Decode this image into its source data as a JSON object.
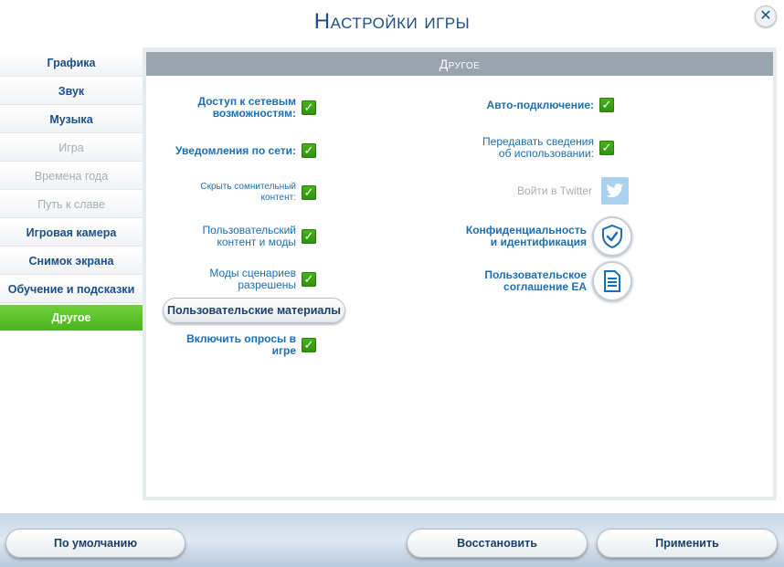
{
  "window": {
    "title": "Настройки игры",
    "close_label": "✕"
  },
  "sidebar": {
    "items": [
      {
        "label": "Графика",
        "state": "normal"
      },
      {
        "label": "Звук",
        "state": "normal"
      },
      {
        "label": "Музыка",
        "state": "normal"
      },
      {
        "label": "Игра",
        "state": "disabled"
      },
      {
        "label": "Времена года",
        "state": "disabled"
      },
      {
        "label": "Путь к славе",
        "state": "disabled"
      },
      {
        "label": "Игровая камера",
        "state": "normal"
      },
      {
        "label": "Снимок экрана",
        "state": "normal"
      },
      {
        "label": "Обучение и подсказки",
        "state": "normal"
      },
      {
        "label": "Другое",
        "state": "active"
      }
    ]
  },
  "panel": {
    "header": "Другое",
    "left_options": [
      {
        "label": "Доступ к сетевым возможностям:",
        "checked": true
      },
      {
        "label": "Уведомления по сети:",
        "checked": true
      },
      {
        "label": "Скрыть сомнительный контент:",
        "checked": true
      },
      {
        "label": "Пользовательский контент и моды",
        "checked": true
      },
      {
        "label": "Моды сценариев разрешены",
        "checked": true
      },
      {
        "label": "Включить опросы в игре",
        "checked": true
      }
    ],
    "custom_materials_button": "Пользовательские материалы",
    "right_options": [
      {
        "label": "Авто-подключение:",
        "checked": true
      },
      {
        "label": "Передавать сведения об использовании:",
        "checked": true
      }
    ],
    "twitter": {
      "label": "Войти в Twitter",
      "icon": "twitter-bird-icon"
    },
    "privacy": {
      "label": "Конфиденциальность и идентификация",
      "icon": "shield-check-icon"
    },
    "agreement": {
      "label": "Пользовательское соглашение EA",
      "icon": "document-icon"
    }
  },
  "footer": {
    "default_button": "По умолчанию",
    "restore_button": "Восстановить",
    "apply_button": "Применить"
  },
  "colors": {
    "accent": "#1b4f8c",
    "option_text": "#1b6fb5",
    "active_tab": "#5cc22c",
    "check_green": "#3fa516",
    "header_gray": "#9aa4af"
  }
}
